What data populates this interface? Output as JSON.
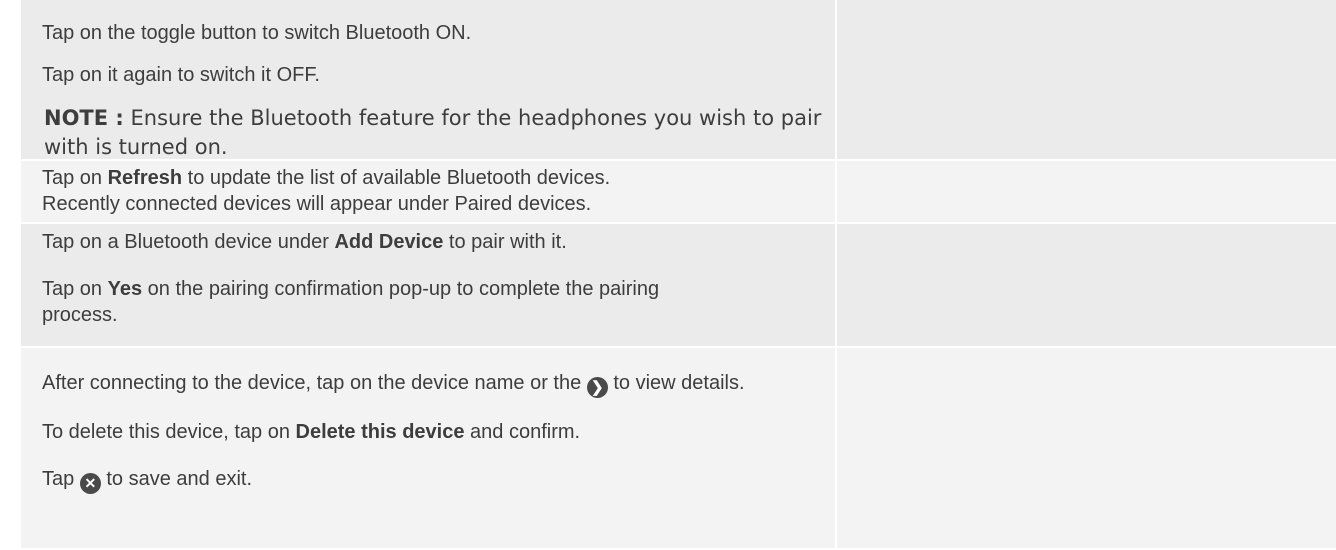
{
  "rows": [
    {
      "p1": "Tap on the toggle button to switch Bluetooth ON.",
      "p2": "Tap on it again to switch it OFF.",
      "note_label": "NOTE :",
      "note_text": " Ensure the Bluetooth feature for the headphones you wish to pair with is turned on."
    },
    {
      "pre": "Tap on ",
      "bold": "Refresh",
      "post": " to update the list of available Bluetooth devices.",
      "line2": "Recently connected devices will appear under Paired devices."
    },
    {
      "p1_pre": "Tap on a Bluetooth device under ",
      "p1_bold": "Add Device",
      "p1_post": " to pair with it.",
      "p2_pre": "Tap on ",
      "p2_bold": "Yes",
      "p2_post": " on the pairing confirmation pop-up to complete the pairing process."
    },
    {
      "p1_pre": "After connecting to the device, tap on the device name or the ",
      "p1_post": " to view details.",
      "p2_pre": "To delete this device, tap on ",
      "p2_bold": "Delete this device",
      "p2_post": " and confirm.",
      "p3_pre": "Tap ",
      "p3_post": " to save and exit."
    }
  ],
  "icons": {
    "details": "chevron-right-icon",
    "exit": "close-circle-icon"
  },
  "colors": {
    "row_gray": "#ebebeb",
    "row_light": "#f3f3f3",
    "text": "#3d3d3d"
  }
}
